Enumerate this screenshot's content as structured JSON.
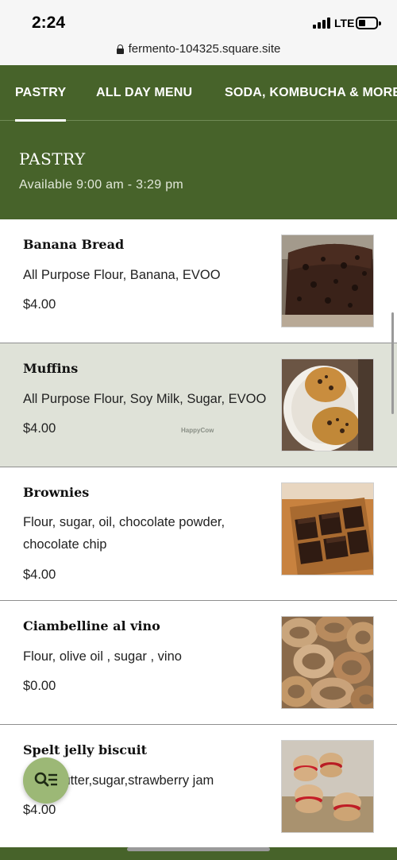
{
  "status": {
    "time": "2:24",
    "network": "LTE"
  },
  "browser": {
    "url": "fermento-104325.square.site"
  },
  "tabs": [
    "PASTRY",
    "ALL DAY MENU",
    "SODA, KOMBUCHA & MORE"
  ],
  "section": {
    "title": "PASTRY",
    "availability": "Available 9:00 am - 3:29 pm"
  },
  "items": [
    {
      "name": "Banana Bread",
      "description": "All Purpose Flour, Banana, EVOO",
      "price": "$4.00"
    },
    {
      "name": "Muffins",
      "description": "All Purpose Flour, Soy Milk, Sugar, EVOO",
      "price": "$4.00"
    },
    {
      "name": "Brownies",
      "description": "Flour, sugar, oil, chocolate powder, chocolate chip",
      "price": "$4.00"
    },
    {
      "name": "Ciambelline al vino",
      "description": "Flour, olive oil , sugar , vino",
      "price": "$0.00"
    },
    {
      "name": "Spelt jelly biscuit",
      "description": "Flour,butter,sugar,strawberry jam",
      "price": "$4.00"
    }
  ],
  "watermark": "HappyCow",
  "icons": {
    "lock": "lock-icon",
    "search_menu": "search-list-icon"
  },
  "colors": {
    "brand_green": "#47632a",
    "fab": "#9cb876",
    "highlight": "#dfe2d8"
  }
}
